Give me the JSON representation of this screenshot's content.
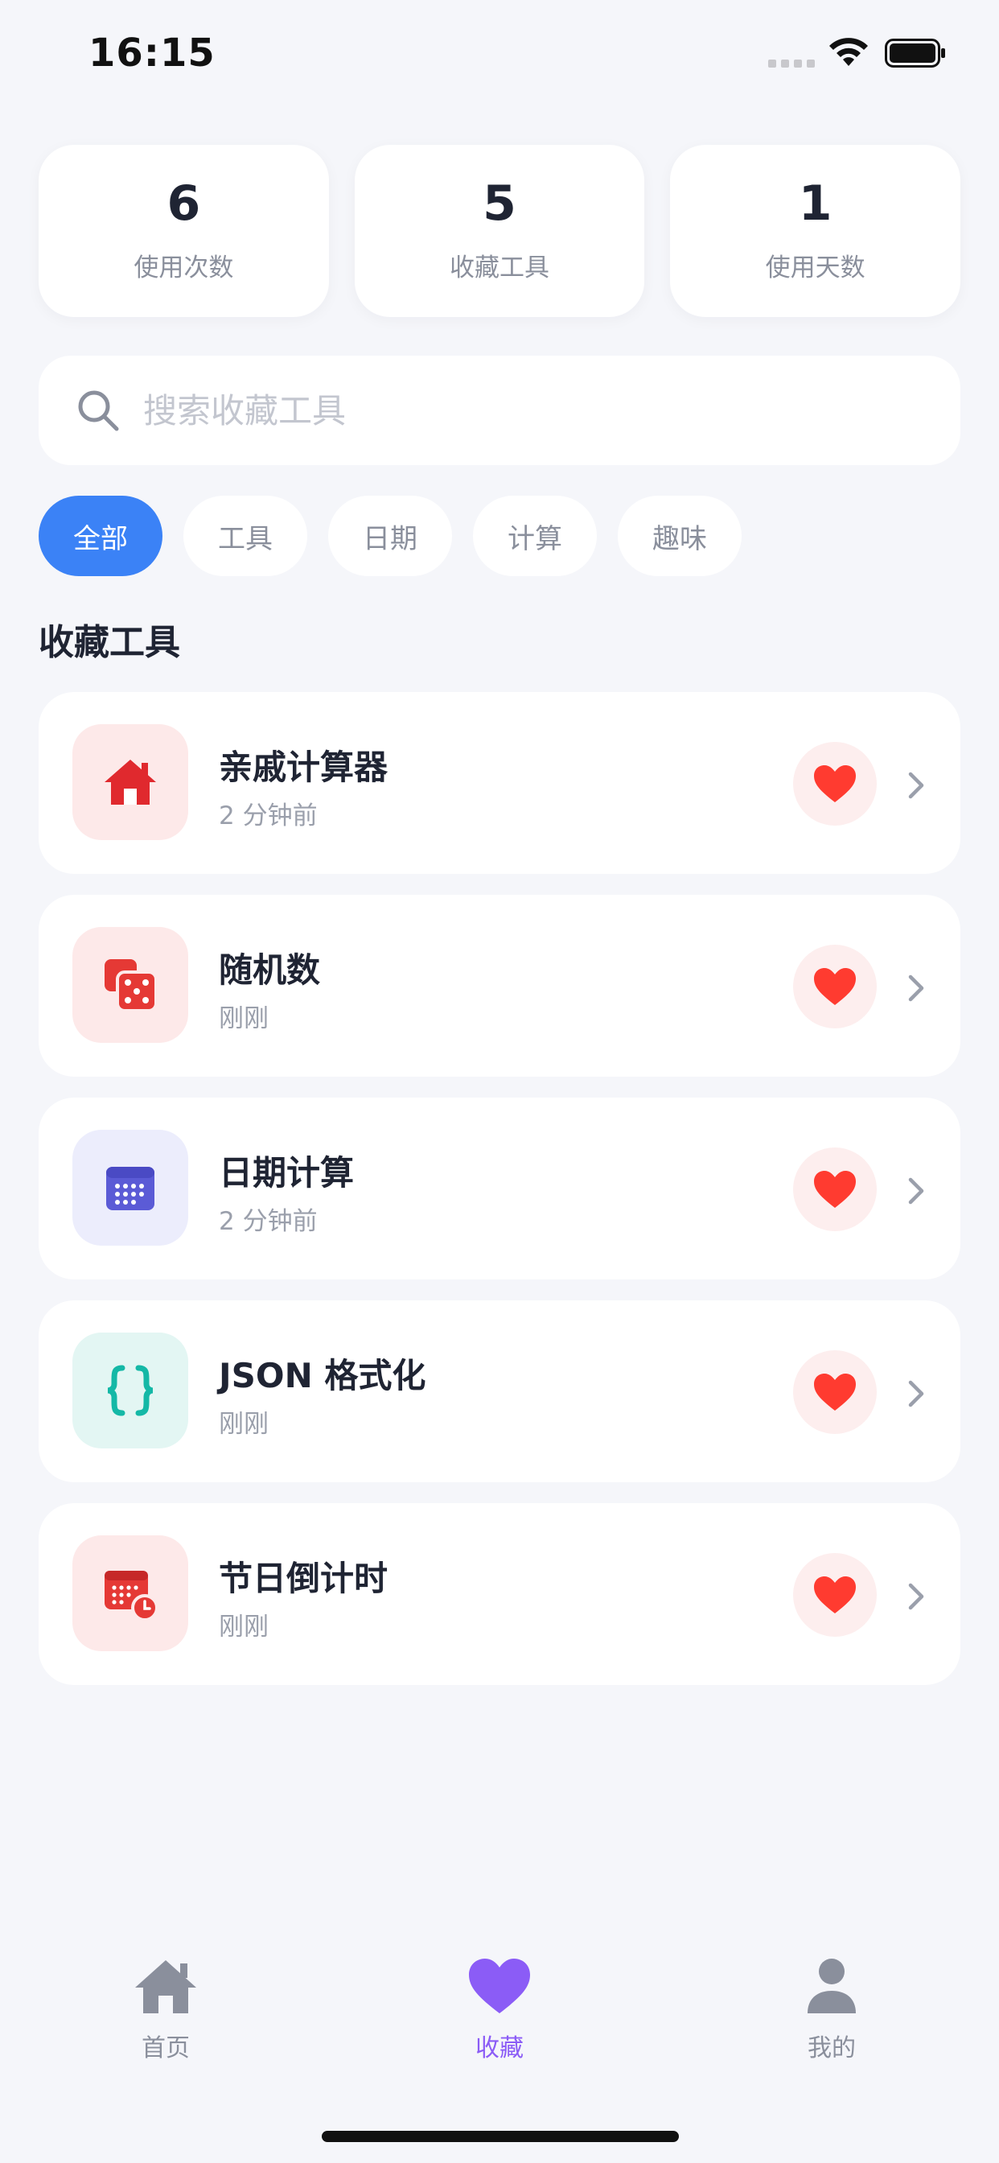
{
  "status_bar": {
    "time": "16:15"
  },
  "stats": [
    {
      "value": "6",
      "label": "使用次数"
    },
    {
      "value": "5",
      "label": "收藏工具"
    },
    {
      "value": "1",
      "label": "使用天数"
    }
  ],
  "search": {
    "placeholder": "搜索收藏工具",
    "value": ""
  },
  "filters": [
    {
      "label": "全部",
      "active": true
    },
    {
      "label": "工具",
      "active": false
    },
    {
      "label": "日期",
      "active": false
    },
    {
      "label": "计算",
      "active": false
    },
    {
      "label": "趣味",
      "active": false
    }
  ],
  "section_title": "收藏工具",
  "tools": [
    {
      "name": "亲戚计算器",
      "time": "2 分钟前",
      "icon": "house-icon",
      "icon_color": "#e0292e",
      "icon_bg": "#fde9e9"
    },
    {
      "name": "随机数",
      "time": "刚刚",
      "icon": "dice-icon",
      "icon_color": "#e53935",
      "icon_bg": "#fde9e9"
    },
    {
      "name": "日期计算",
      "time": "2 分钟前",
      "icon": "calendar-icon",
      "icon_color": "#5b5bd6",
      "icon_bg": "#ecedfc"
    },
    {
      "name": "JSON 格式化",
      "time": "刚刚",
      "icon": "braces-icon",
      "icon_color": "#14b8a6",
      "icon_bg": "#e3f6f3"
    },
    {
      "name": "节日倒计时",
      "time": "刚刚",
      "icon": "calendar-clock-icon",
      "icon_color": "#e53935",
      "icon_bg": "#fde9e9"
    }
  ],
  "tab_bar": [
    {
      "label": "首页",
      "icon": "home-icon",
      "active": false
    },
    {
      "label": "收藏",
      "icon": "heart-icon",
      "active": true
    },
    {
      "label": "我的",
      "icon": "person-icon",
      "active": false
    }
  ],
  "colors": {
    "accent": "#3b82f6",
    "favorite_red": "#ff3b30",
    "tab_active": "#8b5cf6",
    "background": "#f5f6fa"
  }
}
